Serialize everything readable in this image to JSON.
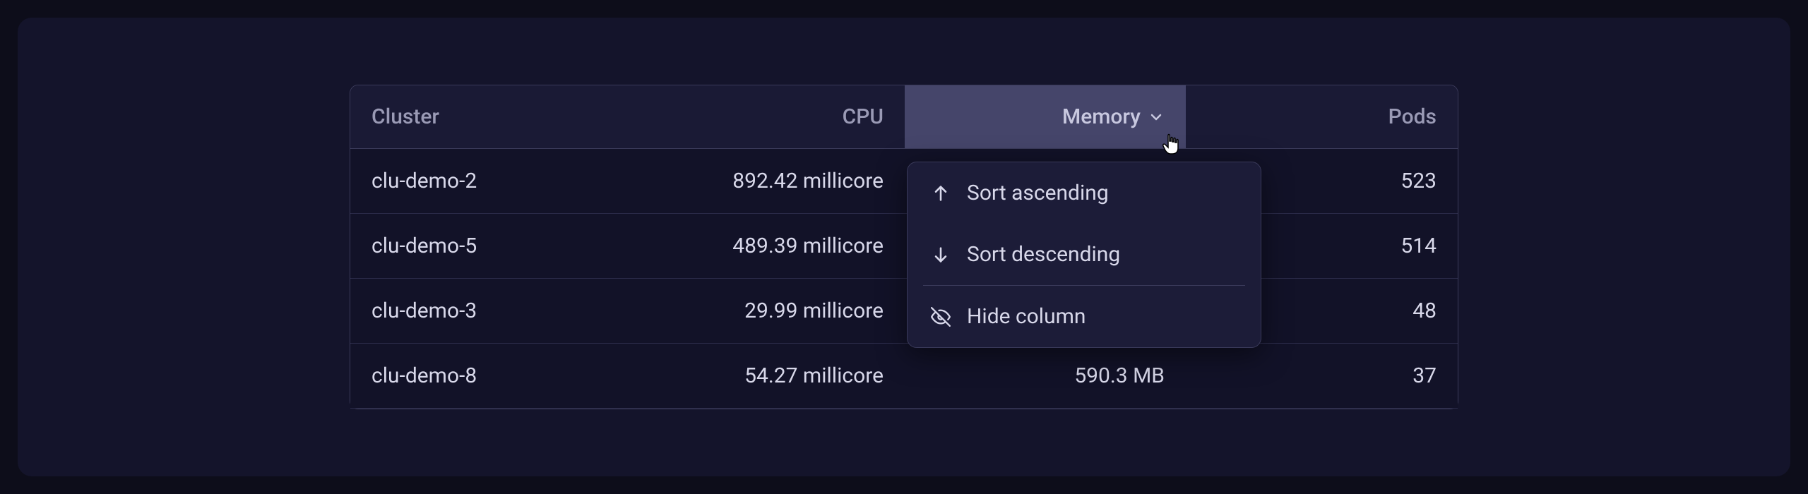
{
  "columns": {
    "cluster": "Cluster",
    "cpu": "CPU",
    "memory": "Memory",
    "pods": "Pods"
  },
  "rows": [
    {
      "cluster": "clu-demo-2",
      "cpu": "892.42 millicore",
      "memory": "",
      "pods": "523"
    },
    {
      "cluster": "clu-demo-5",
      "cpu": "489.39 millicore",
      "memory": "",
      "pods": "514"
    },
    {
      "cluster": "clu-demo-3",
      "cpu": "29.99 millicore",
      "memory": "",
      "pods": "48"
    },
    {
      "cluster": "clu-demo-8",
      "cpu": "54.27 millicore",
      "memory": "590.3 MB",
      "pods": "37"
    }
  ],
  "dropdown": {
    "sort_ascending": "Sort ascending",
    "sort_descending": "Sort descending",
    "hide_column": "Hide column"
  }
}
